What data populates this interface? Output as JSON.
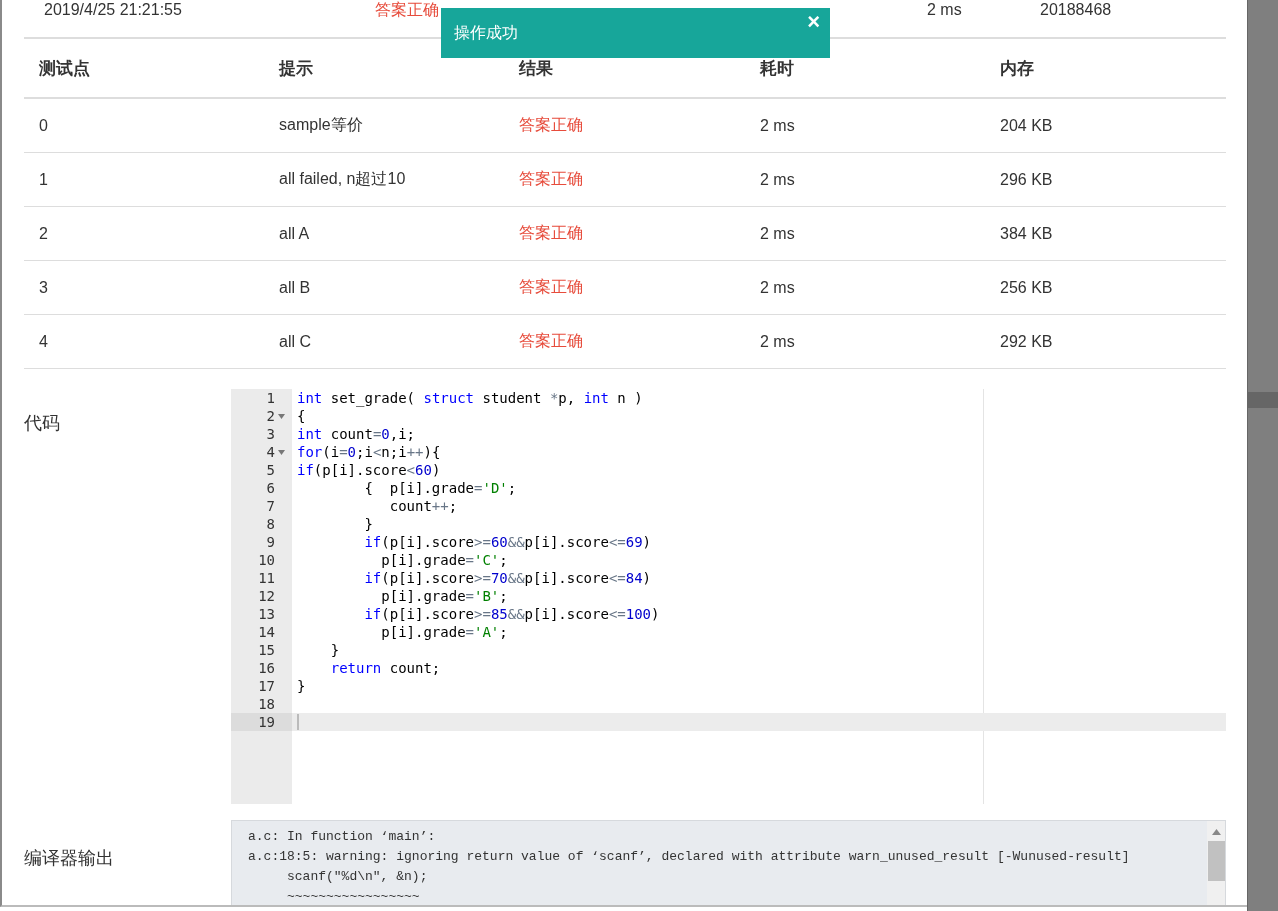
{
  "submission_row": {
    "time": "2019/4/25 21:21:55",
    "result": "答案正确",
    "duration": "2 ms",
    "user": "20188468"
  },
  "toast": {
    "message": "操作成功",
    "close": "×"
  },
  "testcases": {
    "columns": [
      "测试点",
      "提示",
      "结果",
      "耗时",
      "内存"
    ],
    "rows": [
      {
        "id": "0",
        "hint": "sample等价",
        "result": "答案正确",
        "time": "2 ms",
        "memory": "204 KB"
      },
      {
        "id": "1",
        "hint": "all failed, n超过10",
        "result": "答案正确",
        "time": "2 ms",
        "memory": "296 KB"
      },
      {
        "id": "2",
        "hint": "all A",
        "result": "答案正确",
        "time": "2 ms",
        "memory": "384 KB"
      },
      {
        "id": "3",
        "hint": "all B",
        "result": "答案正确",
        "time": "2 ms",
        "memory": "256 KB"
      },
      {
        "id": "4",
        "hint": "all C",
        "result": "答案正确",
        "time": "2 ms",
        "memory": "292 KB"
      }
    ]
  },
  "code": {
    "label": "代码",
    "lines": [
      {
        "number": "1",
        "foldable": false,
        "active": false,
        "tokens": [
          {
            "kind": "kw",
            "text": "int"
          },
          {
            "kind": "plain",
            "text": " set_grade( "
          },
          {
            "kind": "kw",
            "text": "struct"
          },
          {
            "kind": "plain",
            "text": " student "
          },
          {
            "kind": "op",
            "text": "*"
          },
          {
            "kind": "plain",
            "text": "p, "
          },
          {
            "kind": "kw",
            "text": "int"
          },
          {
            "kind": "plain",
            "text": " n )"
          }
        ]
      },
      {
        "number": "2",
        "foldable": true,
        "active": false,
        "tokens": [
          {
            "kind": "plain",
            "text": "{"
          }
        ]
      },
      {
        "number": "3",
        "foldable": false,
        "active": false,
        "tokens": [
          {
            "kind": "kw",
            "text": "int"
          },
          {
            "kind": "plain",
            "text": " count"
          },
          {
            "kind": "op",
            "text": "="
          },
          {
            "kind": "num",
            "text": "0"
          },
          {
            "kind": "plain",
            "text": ",i;"
          }
        ]
      },
      {
        "number": "4",
        "foldable": true,
        "active": false,
        "tokens": [
          {
            "kind": "kw",
            "text": "for"
          },
          {
            "kind": "plain",
            "text": "(i"
          },
          {
            "kind": "op",
            "text": "="
          },
          {
            "kind": "num",
            "text": "0"
          },
          {
            "kind": "plain",
            "text": ";i"
          },
          {
            "kind": "op",
            "text": "<"
          },
          {
            "kind": "plain",
            "text": "n;i"
          },
          {
            "kind": "op",
            "text": "++"
          },
          {
            "kind": "plain",
            "text": "){"
          }
        ]
      },
      {
        "number": "5",
        "foldable": false,
        "active": false,
        "tokens": [
          {
            "kind": "kw",
            "text": "if"
          },
          {
            "kind": "plain",
            "text": "(p[i].score"
          },
          {
            "kind": "op",
            "text": "<"
          },
          {
            "kind": "num",
            "text": "60"
          },
          {
            "kind": "plain",
            "text": ")"
          }
        ]
      },
      {
        "number": "6",
        "foldable": false,
        "active": false,
        "tokens": [
          {
            "kind": "plain",
            "text": "        {  p[i].grade"
          },
          {
            "kind": "op",
            "text": "="
          },
          {
            "kind": "str",
            "text": "'D'"
          },
          {
            "kind": "plain",
            "text": ";"
          }
        ]
      },
      {
        "number": "7",
        "foldable": false,
        "active": false,
        "tokens": [
          {
            "kind": "plain",
            "text": "           count"
          },
          {
            "kind": "op",
            "text": "++"
          },
          {
            "kind": "plain",
            "text": ";"
          }
        ]
      },
      {
        "number": "8",
        "foldable": false,
        "active": false,
        "tokens": [
          {
            "kind": "plain",
            "text": "        }"
          }
        ]
      },
      {
        "number": "9",
        "foldable": false,
        "active": false,
        "tokens": [
          {
            "kind": "kw",
            "text": "        if"
          },
          {
            "kind": "plain",
            "text": "(p[i].score"
          },
          {
            "kind": "op",
            "text": ">="
          },
          {
            "kind": "num",
            "text": "60"
          },
          {
            "kind": "op",
            "text": "&&"
          },
          {
            "kind": "plain",
            "text": "p[i].score"
          },
          {
            "kind": "op",
            "text": "<="
          },
          {
            "kind": "num",
            "text": "69"
          },
          {
            "kind": "plain",
            "text": ")"
          }
        ]
      },
      {
        "number": "10",
        "foldable": false,
        "active": false,
        "tokens": [
          {
            "kind": "plain",
            "text": "          p[i].grade"
          },
          {
            "kind": "op",
            "text": "="
          },
          {
            "kind": "str",
            "text": "'C'"
          },
          {
            "kind": "plain",
            "text": ";"
          }
        ]
      },
      {
        "number": "11",
        "foldable": false,
        "active": false,
        "tokens": [
          {
            "kind": "kw",
            "text": "        if"
          },
          {
            "kind": "plain",
            "text": "(p[i].score"
          },
          {
            "kind": "op",
            "text": ">="
          },
          {
            "kind": "num",
            "text": "70"
          },
          {
            "kind": "op",
            "text": "&&"
          },
          {
            "kind": "plain",
            "text": "p[i].score"
          },
          {
            "kind": "op",
            "text": "<="
          },
          {
            "kind": "num",
            "text": "84"
          },
          {
            "kind": "plain",
            "text": ")"
          }
        ]
      },
      {
        "number": "12",
        "foldable": false,
        "active": false,
        "tokens": [
          {
            "kind": "plain",
            "text": "          p[i].grade"
          },
          {
            "kind": "op",
            "text": "="
          },
          {
            "kind": "str",
            "text": "'B'"
          },
          {
            "kind": "plain",
            "text": ";"
          }
        ]
      },
      {
        "number": "13",
        "foldable": false,
        "active": false,
        "tokens": [
          {
            "kind": "kw",
            "text": "        if"
          },
          {
            "kind": "plain",
            "text": "(p[i].score"
          },
          {
            "kind": "op",
            "text": ">="
          },
          {
            "kind": "num",
            "text": "85"
          },
          {
            "kind": "op",
            "text": "&&"
          },
          {
            "kind": "plain",
            "text": "p[i].score"
          },
          {
            "kind": "op",
            "text": "<="
          },
          {
            "kind": "num",
            "text": "100"
          },
          {
            "kind": "plain",
            "text": ")"
          }
        ]
      },
      {
        "number": "14",
        "foldable": false,
        "active": false,
        "tokens": [
          {
            "kind": "plain",
            "text": "          p[i].grade"
          },
          {
            "kind": "op",
            "text": "="
          },
          {
            "kind": "str",
            "text": "'A'"
          },
          {
            "kind": "plain",
            "text": ";"
          }
        ]
      },
      {
        "number": "15",
        "foldable": false,
        "active": false,
        "tokens": [
          {
            "kind": "plain",
            "text": "    }"
          }
        ]
      },
      {
        "number": "16",
        "foldable": false,
        "active": false,
        "tokens": [
          {
            "kind": "kw",
            "text": "    return"
          },
          {
            "kind": "plain",
            "text": " count;"
          }
        ]
      },
      {
        "number": "17",
        "foldable": false,
        "active": false,
        "tokens": [
          {
            "kind": "plain",
            "text": "}"
          }
        ]
      },
      {
        "number": "18",
        "foldable": false,
        "active": false
      },
      {
        "number": "19",
        "foldable": false,
        "active": true
      }
    ]
  },
  "compiler_output": {
    "label": "编译器输出",
    "lines": [
      "a.c: In function ‘main’:",
      "a.c:18:5: warning: ignoring return value of ‘scanf’, declared with attribute warn_unused_result [-Wunused-result]",
      "     scanf(\"%d\\n\", &n);",
      "     ~~~~~~~~~~~~~~~~~"
    ]
  }
}
